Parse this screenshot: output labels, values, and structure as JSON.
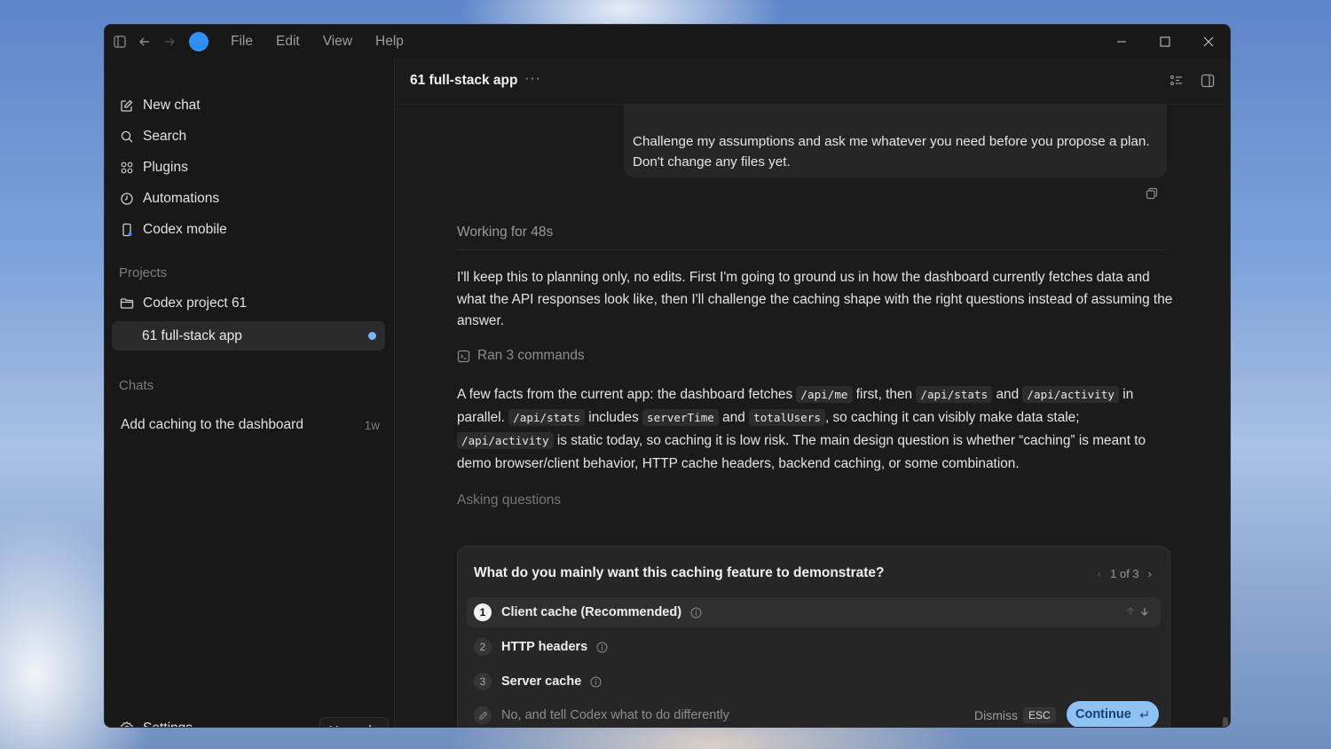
{
  "menu": [
    "File",
    "Edit",
    "View",
    "Help"
  ],
  "sidebar": {
    "items": [
      {
        "label": "New chat",
        "icon": "edit-icon"
      },
      {
        "label": "Search",
        "icon": "search-icon"
      },
      {
        "label": "Plugins",
        "icon": "grid-icon"
      },
      {
        "label": "Automations",
        "icon": "clock-icon"
      },
      {
        "label": "Codex mobile",
        "icon": "phone-icon"
      }
    ],
    "projects_heading": "Projects",
    "project": {
      "label": "Codex project 61",
      "icon": "folder-icon"
    },
    "active_thread": "61 full-stack app",
    "chats_heading": "Chats",
    "chat": {
      "label": "Add caching to the dashboard",
      "age": "1w"
    },
    "settings_label": "Settings",
    "upgrade_label": "Upgrade"
  },
  "header": {
    "title": "61 full-stack app",
    "more": "···"
  },
  "conversation": {
    "user_message": "Challenge my assumptions and ask me whatever you need before you propose a plan. Don't change any files yet.",
    "working_label": "Working for 48s",
    "assistant_para1": "I'll keep this to planning only, no edits. First I'm going to ground us in how the dashboard currently fetches data and what the API responses look like, then I'll challenge the caching shape with the right questions instead of assuming the answer.",
    "ran_label": "Ran 3 commands",
    "para2": {
      "t1": "A few facts from the current app: the dashboard fetches ",
      "c1": "/api/me",
      "t2": " first, then ",
      "c2": "/api/stats",
      "t3": " and ",
      "c3": "/api/activity",
      "t4": " in parallel. ",
      "c4": "/api/stats",
      "t5": " includes ",
      "c5": "serverTime",
      "t6": " and ",
      "c6": "totalUsers",
      "t7": ", so caching it can visibly make data stale; ",
      "c7": "/api/activity",
      "t8": " is static today, so caching it is low risk. The main design question is whether “caching” is meant to demo browser/client behavior, HTTP cache headers, backend caching, or some combination."
    },
    "asking_label": "Asking questions"
  },
  "question": {
    "title": "What do you mainly want this caching feature to demonstrate?",
    "pager": "1 of 3",
    "options": [
      {
        "num": "1",
        "label": "Client cache (Recommended)"
      },
      {
        "num": "2",
        "label": "HTTP headers"
      },
      {
        "num": "3",
        "label": "Server cache"
      }
    ],
    "other_placeholder": "No, and tell Codex what to do differently",
    "dismiss_label": "Dismiss",
    "esc_label": "ESC",
    "continue_label": "Continue"
  },
  "colors": {
    "accent": "#2f8ff4",
    "continue_bg": "#8ec2f4",
    "unread_dot": "#7ab6ff"
  }
}
